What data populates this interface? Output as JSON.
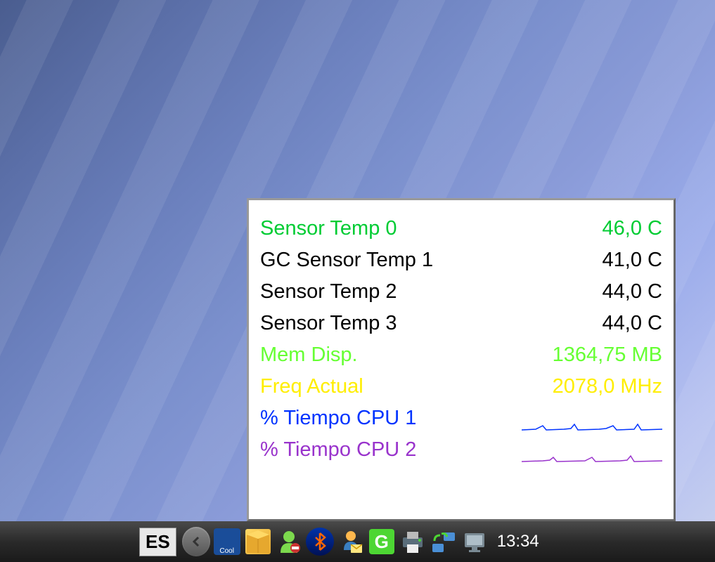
{
  "sensor_panel": {
    "rows": [
      {
        "label": "Sensor Temp 0",
        "value": "46,0 C",
        "color": "sensor-green"
      },
      {
        "label": "GC Sensor Temp 1",
        "value": "41,0 C",
        "color": "sensor-black"
      },
      {
        "label": "Sensor Temp 2",
        "value": "44,0 C",
        "color": "sensor-black"
      },
      {
        "label": "Sensor Temp 3",
        "value": "44,0 C",
        "color": "sensor-black"
      },
      {
        "label": "Mem Disp.",
        "value": "1364,75 MB",
        "color": "sensor-lime"
      },
      {
        "label": "Freq Actual",
        "value": "2078,0 MHz",
        "color": "sensor-yellow"
      },
      {
        "label": "% Tiempo CPU 1",
        "value": "",
        "color": "sensor-blue",
        "sparkline": true
      },
      {
        "label": "% Tiempo CPU 2",
        "value": "",
        "color": "sensor-purple",
        "sparkline": true
      }
    ]
  },
  "taskbar": {
    "language": "ES",
    "clock": "13:34",
    "icons": {
      "book_label": "Cool",
      "g_label": "G"
    }
  }
}
